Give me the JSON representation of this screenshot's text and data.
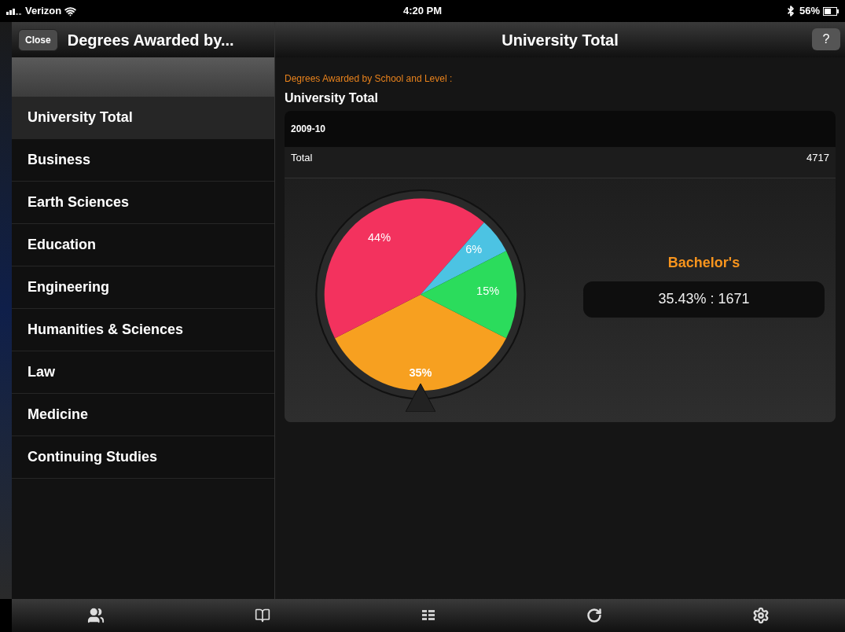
{
  "status_bar": {
    "carrier": "Verizon",
    "time": "4:20 PM",
    "battery": "56%"
  },
  "sidebar": {
    "close_button": "Close",
    "title": "Degrees Awarded by...",
    "items": [
      {
        "label": "University Total",
        "selected": true
      },
      {
        "label": "Business",
        "selected": false
      },
      {
        "label": "Earth Sciences",
        "selected": false
      },
      {
        "label": "Education",
        "selected": false
      },
      {
        "label": "Engineering",
        "selected": false
      },
      {
        "label": "Humanities & Sciences",
        "selected": false
      },
      {
        "label": "Law",
        "selected": false
      },
      {
        "label": "Medicine",
        "selected": false
      },
      {
        "label": "Continuing Studies",
        "selected": false
      }
    ]
  },
  "main": {
    "title": "University Total",
    "help_button": "?",
    "subtitle": "Degrees Awarded by School and Level :",
    "heading": "University Total",
    "table": {
      "header": "2009-10",
      "rows": [
        {
          "label": "Total",
          "value": "4717"
        }
      ]
    },
    "chart_data": {
      "type": "pie",
      "values": [
        35,
        44,
        6,
        15
      ],
      "value_labels": [
        "35%",
        "44%",
        "6%",
        "15%"
      ],
      "colors": [
        "#f7a020",
        "#f3325e",
        "#4cc3e3",
        "#2bdc5c"
      ]
    },
    "detail": {
      "label": "Bachelor's",
      "reading": "35.43% : 1671"
    }
  },
  "tab_bar": [
    {
      "kind": "people"
    },
    {
      "kind": "book"
    },
    {
      "kind": "codes"
    },
    {
      "kind": "refresh"
    },
    {
      "kind": "settings"
    }
  ]
}
